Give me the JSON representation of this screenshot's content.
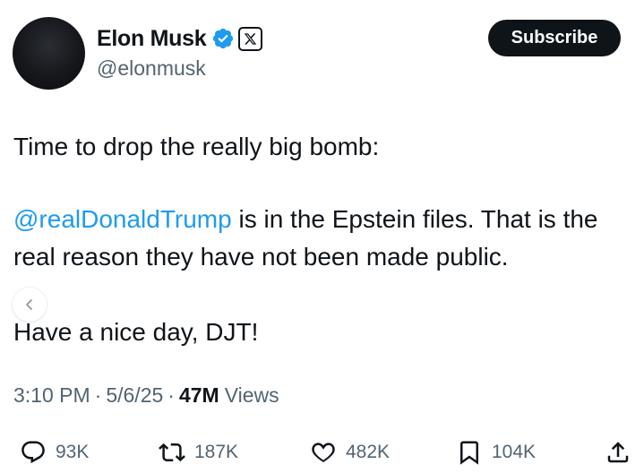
{
  "tweet": {
    "author": {
      "display_name": "Elon Musk",
      "handle": "@elonmusk"
    },
    "subscribe_label": "Subscribe",
    "lines": {
      "line1": "Time to drop the really big bomb:",
      "mention": "@realDonaldTrump",
      "para2_rest": " is in the Epstein files. That is the real reason they have not been made public.",
      "line4": "Have a nice day, DJT!"
    },
    "meta": {
      "time": "3:10 PM",
      "date": "5/6/25",
      "views_count": "47M",
      "views_label": "Views",
      "separator": "·"
    },
    "actions": {
      "replies": "93K",
      "reposts": "187K",
      "likes": "482K",
      "bookmarks": "104K"
    }
  },
  "colors": {
    "mention_blue": "#1d9bf0",
    "verified_blue": "#1d9bf0",
    "secondary_text": "#536471",
    "primary_text": "#0f1419"
  }
}
